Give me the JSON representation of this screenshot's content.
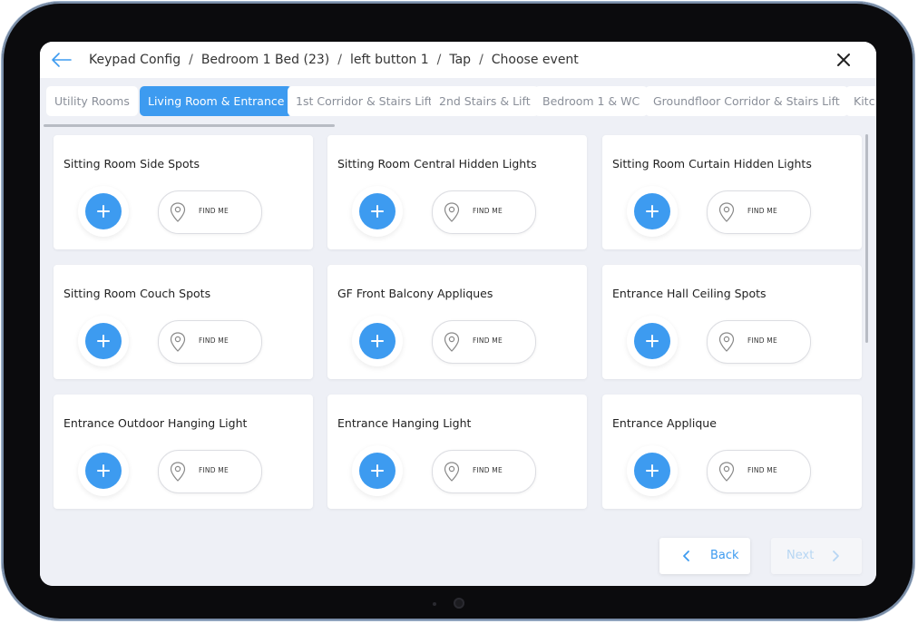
{
  "header": {
    "breadcrumb": [
      "Keypad Config",
      "Bedroom 1 Bed (23)",
      "left button 1",
      "Tap",
      "Choose event"
    ],
    "separator": "/"
  },
  "tabs": [
    {
      "label": "Utility Rooms",
      "active": false
    },
    {
      "label": "Living Room & Entrance",
      "active": true
    },
    {
      "label": "1st Corridor & Stairs Lift",
      "active": false
    },
    {
      "label": "2nd Stairs & Lift",
      "active": false
    },
    {
      "label": "Bedroom 1 & WC",
      "active": false
    },
    {
      "label": "Groundfloor Corridor & Stairs Lift",
      "active": false
    },
    {
      "label": "Kitc",
      "active": false
    }
  ],
  "cards": [
    {
      "title": "Sitting Room Side Spots",
      "find_label": "FIND ME"
    },
    {
      "title": "Sitting Room Central Hidden Lights",
      "find_label": "FIND ME"
    },
    {
      "title": "Sitting Room Curtain Hidden Lights",
      "find_label": "FIND ME"
    },
    {
      "title": "Sitting Room Couch Spots",
      "find_label": "FIND ME"
    },
    {
      "title": "GF Front Balcony Appliques",
      "find_label": "FIND ME"
    },
    {
      "title": "Entrance Hall Ceiling Spots",
      "find_label": "FIND ME"
    },
    {
      "title": "Entrance Outdoor Hanging Light",
      "find_label": "FIND ME"
    },
    {
      "title": "Entrance Hanging Light",
      "find_label": "FIND ME"
    },
    {
      "title": "Entrance Applique",
      "find_label": "FIND ME"
    }
  ],
  "footer": {
    "back_label": "Back",
    "next_label": "Next"
  },
  "colors": {
    "accent": "#3d9bf0",
    "background": "#eef0f6",
    "card": "#ffffff",
    "disabled_text": "#b7d6f3"
  },
  "icons": {
    "back": "arrow-left-icon",
    "close": "close-icon",
    "add": "plus-icon",
    "find": "map-pin-icon",
    "back_button": "chevron-left-icon",
    "next_button": "chevron-right-icon"
  }
}
